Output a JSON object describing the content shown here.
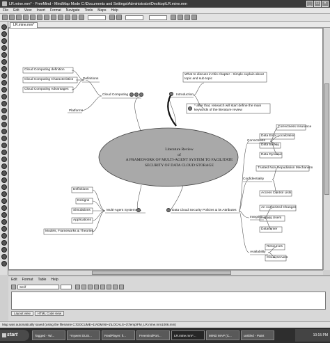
{
  "window": {
    "title": "LR.mine.mm* - FreeMind - MindMap Mode C:\\Documents and Settings\\Administrator\\Desktop\\LR.mine.mm",
    "minimize": "_",
    "maximize": "□",
    "close": "×"
  },
  "menu": [
    "File",
    "Edit",
    "View",
    "Insert",
    "Format",
    "Navigate",
    "Tools",
    "Maps",
    "Help"
  ],
  "tab": {
    "label": "LR.mine.mm*"
  },
  "map": {
    "center": {
      "line1": "Literature Review",
      "line2": "of",
      "line3": "A FRAMEWORK OF MULTI-AGENT SYSTEM TO FACILITATE",
      "line4": "SECURITY OF DATA CLOUD STORAGE"
    },
    "cloud_computing": {
      "label": "Cloud Computing",
      "definitions": "Definitions",
      "platforms": "Platforms",
      "children": [
        "Cloud Computing definition",
        "Cloud Computing Characteristics",
        "Cloud Computing Advantages"
      ]
    },
    "introduction": {
      "label": "Introduction",
      "note1": "What to discuss in this chapter - Simple explain about topic and sub topic",
      "note2": "* after that, research will start define the main keywords of the literature review"
    },
    "multi_agent": {
      "label": "Multi-Agent Systems",
      "children": [
        "Definitions",
        "Designs",
        "Simulations",
        "Applications",
        "Models, Frameworks & Theories"
      ]
    },
    "security_policies": {
      "label": "Data Cloud Security Policies & its Attributes",
      "correctness": "Correctness",
      "correctness_children": [
        "Correctness Insurance",
        "Data Error Localization",
        "Data Blocks",
        "Data Dynamic"
      ],
      "confidentiality": "Confidentiality",
      "confidentiality_children": [
        "Trusted Non-Repudiation Mechanism",
        "Access Control Lists"
      ],
      "integrity": "Integrity",
      "integrity_children": [
        "An Authorized Changes",
        "Access Users",
        "Datacenter"
      ],
      "availability": "Availability",
      "availability_children": [
        "Resources",
        "Cloud Servers"
      ]
    }
  },
  "editor": {
    "menu": [
      "Edit",
      "Format",
      "Table",
      "Help"
    ],
    "font": "Serif",
    "tabs": [
      "Layout view",
      "HTML Code view"
    ]
  },
  "status": "Map was automatically saved (using the filename C:\\DOCUME~1\\ADMINI~1\\LOCALS~1\\Temp\\FM_LR.mine.mm1006.mm)",
  "taskbar": {
    "start": "start",
    "buttons": [
      "Tagged - Wi...",
      "*mywen:OLIS...",
      "RealPlayer: li...",
      "FreemindPort...",
      "LR.mine.mm*...",
      "MIND MAP (C...",
      "untitled - Paint"
    ],
    "active_index": 4,
    "clock": "10:15 PM"
  }
}
